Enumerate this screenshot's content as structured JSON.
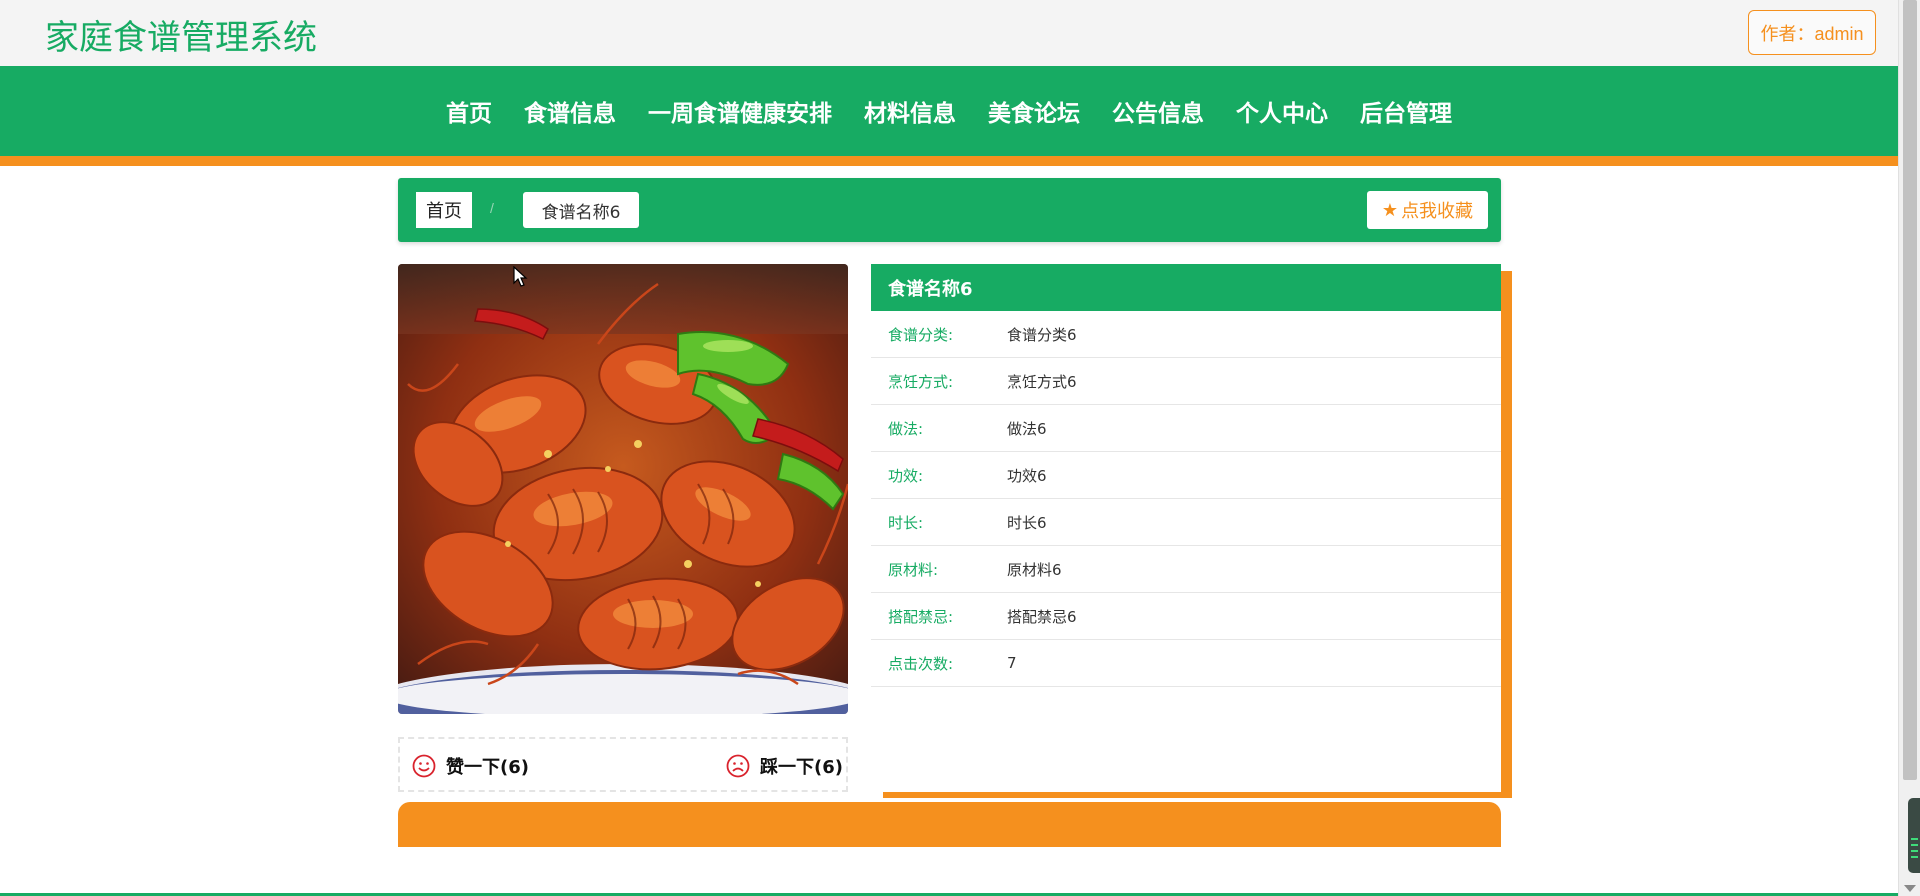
{
  "header": {
    "site_title": "家庭食谱管理系统",
    "author_label": "作者：admin"
  },
  "nav": {
    "items": [
      {
        "label": "首页"
      },
      {
        "label": "食谱信息"
      },
      {
        "label": "一周食谱健康安排"
      },
      {
        "label": "材料信息"
      },
      {
        "label": "美食论坛"
      },
      {
        "label": "公告信息"
      },
      {
        "label": "个人中心"
      },
      {
        "label": "后台管理"
      }
    ]
  },
  "breadcrumb": {
    "home": "首页",
    "separator": "/",
    "current": "食谱名称6"
  },
  "favorite_button": {
    "icon": "star-icon",
    "label": "点我收藏"
  },
  "image": {
    "description_icon": "crayfish-dish-photo"
  },
  "reactions": {
    "like": {
      "icon": "smile-icon",
      "label": "赞一下(6)"
    },
    "dislike": {
      "icon": "frown-icon",
      "label": "踩一下(6)"
    }
  },
  "detail": {
    "title": "食谱名称6",
    "rows": [
      {
        "label": "食谱分类:",
        "value": "食谱分类6"
      },
      {
        "label": "烹饪方式:",
        "value": "烹饪方式6"
      },
      {
        "label": "做法:",
        "value": "做法6"
      },
      {
        "label": "功效:",
        "value": "功效6"
      },
      {
        "label": "时长:",
        "value": "时长6"
      },
      {
        "label": "原材料:",
        "value": "原材料6"
      },
      {
        "label": "搭配禁忌:",
        "value": "搭配禁忌6"
      },
      {
        "label": "点击次数:",
        "value": "7"
      }
    ]
  },
  "colors": {
    "primary_green": "#17ab63",
    "accent_orange": "#f5901e",
    "reaction_red": "#d9232d"
  }
}
